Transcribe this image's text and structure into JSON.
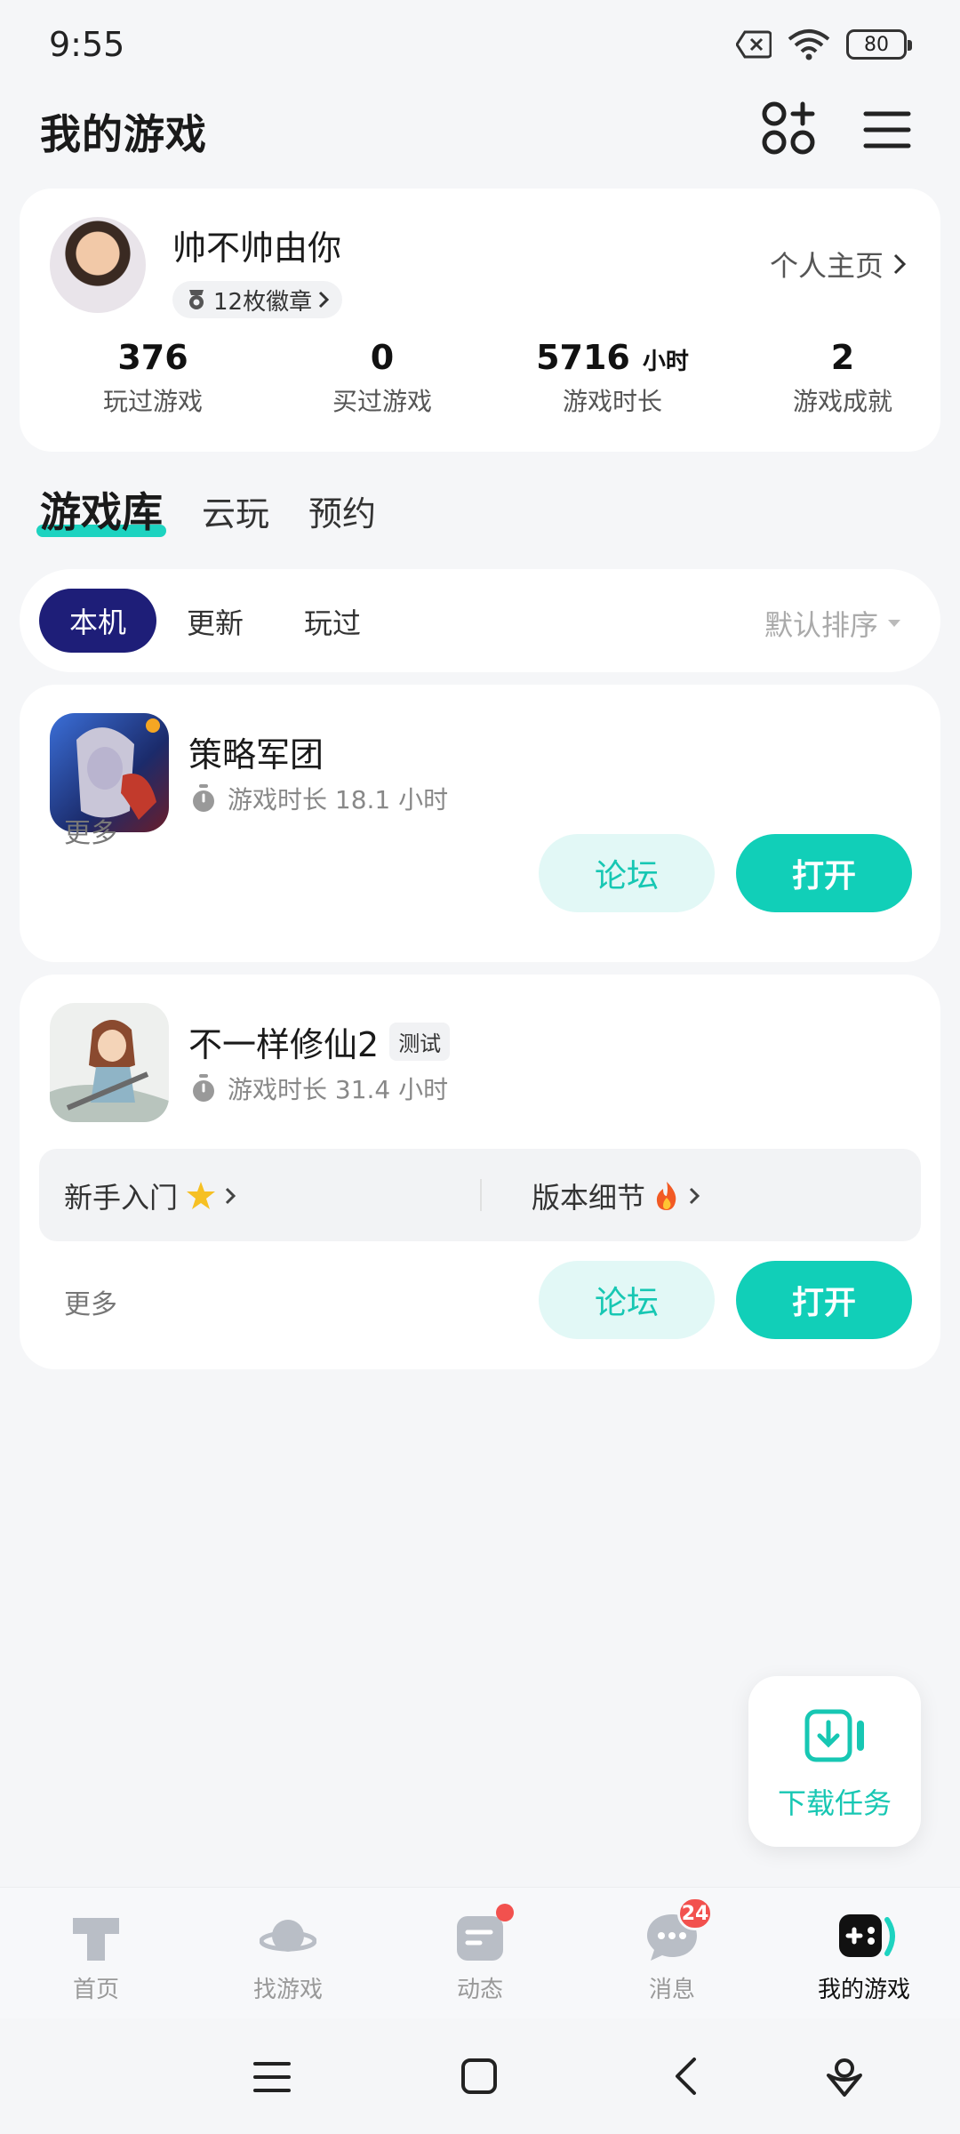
{
  "status_bar": {
    "time": "9:55",
    "battery": "80"
  },
  "header": {
    "title": "我的游戏"
  },
  "profile": {
    "username": "帅不帅由你",
    "badges": "12枚徽章",
    "profile_link": "个人主页",
    "stats": [
      {
        "value": "376",
        "unit": "",
        "label": "玩过游戏"
      },
      {
        "value": "0",
        "unit": "",
        "label": "买过游戏"
      },
      {
        "value": "5716",
        "unit": "小时",
        "label": "游戏时长"
      },
      {
        "value": "2",
        "unit": "",
        "label": "游戏成就"
      }
    ]
  },
  "library_tabs": {
    "active": "游戏库",
    "cloud": "云玩",
    "reserve": "预约"
  },
  "filters": {
    "local": "本机",
    "updates": "更新",
    "played": "玩过",
    "sort": "默认排序"
  },
  "games": [
    {
      "name": "策略军团",
      "playtime": "游戏时长 18.1 小时",
      "more": "更多",
      "forum": "论坛",
      "open": "打开"
    },
    {
      "name": "不一样修仙2",
      "tag": "测试",
      "playtime": "游戏时长 31.4 小时",
      "guides": [
        "新手入门",
        "版本细节"
      ],
      "more": "更多",
      "forum": "论坛",
      "open": "打开"
    }
  ],
  "download_fab": {
    "label": "下载任务"
  },
  "bottom_nav": {
    "items": [
      {
        "label": "首页"
      },
      {
        "label": "找游戏"
      },
      {
        "label": "动态"
      },
      {
        "label": "消息",
        "badge": "24"
      },
      {
        "label": "我的游戏"
      }
    ]
  },
  "colors": {
    "accent": "#11cfb8",
    "filter_active": "#1e1e78",
    "badge_red": "#f2514e"
  }
}
